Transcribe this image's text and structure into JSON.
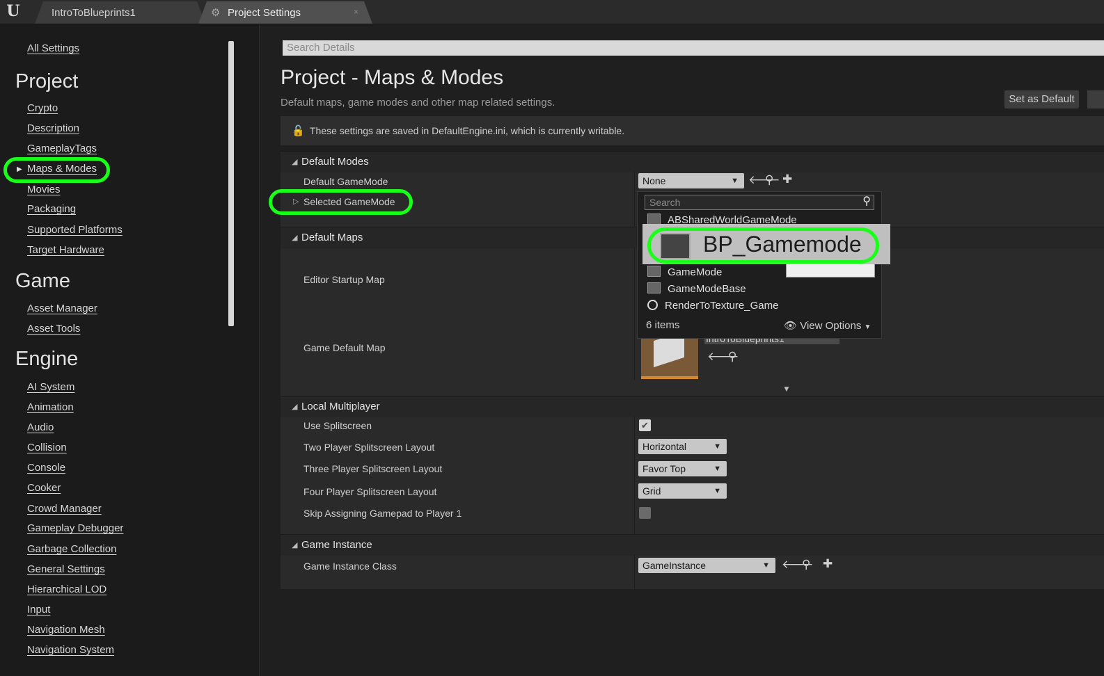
{
  "titlebar": {
    "tabs": [
      {
        "label": "IntroToBlueprints1"
      },
      {
        "label": "Project Settings"
      }
    ]
  },
  "sidebar": {
    "all_settings": "All Settings",
    "sections": [
      {
        "title": "Project",
        "items": [
          "Crypto",
          "Description",
          "GameplayTags",
          "Maps & Modes",
          "Movies",
          "Packaging",
          "Supported Platforms",
          "Target Hardware"
        ]
      },
      {
        "title": "Game",
        "items": [
          "Asset Manager",
          "Asset Tools"
        ]
      },
      {
        "title": "Engine",
        "items": [
          "AI System",
          "Animation",
          "Audio",
          "Collision",
          "Console",
          "Cooker",
          "Crowd Manager",
          "Gameplay Debugger",
          "Garbage Collection",
          "General Settings",
          "Hierarchical LOD",
          "Input",
          "Navigation Mesh",
          "Navigation System"
        ]
      }
    ],
    "selected": "Maps & Modes"
  },
  "main": {
    "search_placeholder": "Search Details",
    "title": "Project - Maps & Modes",
    "subtitle": "Default maps, game modes and other map related settings.",
    "set_default": "Set as Default",
    "notice": "These settings are saved in DefaultEngine.ini, which is currently writable.",
    "sections": {
      "default_modes": {
        "title": "Default Modes",
        "default_gamemode_label": "Default GameMode",
        "default_gamemode_value": "None",
        "selected_gamemode_label": "Selected GameMode"
      },
      "default_maps": {
        "title": "Default Maps",
        "editor_startup_map_label": "Editor Startup Map",
        "game_default_map_label": "Game Default Map",
        "game_default_map_value": "IntroToBlueprints1"
      },
      "local_multiplayer": {
        "title": "Local Multiplayer",
        "use_splitscreen_label": "Use Splitscreen",
        "two_player_label": "Two Player Splitscreen Layout",
        "two_player_value": "Horizontal",
        "three_player_label": "Three Player Splitscreen Layout",
        "three_player_value": "Favor Top",
        "four_player_label": "Four Player Splitscreen Layout",
        "four_player_value": "Grid",
        "skip_gamepad_label": "Skip Assigning Gamepad to Player 1"
      },
      "game_instance": {
        "title": "Game Instance",
        "class_label": "Game Instance Class",
        "class_value": "GameInstance"
      }
    }
  },
  "popup": {
    "search_placeholder": "Search",
    "items": [
      "ABSharedWorldGameMode",
      "BP_Gamemode",
      "GameMode",
      "GameModeBase",
      "RenderToTexture_Game"
    ],
    "count": "6 items",
    "view_options": "View Options"
  },
  "colors": {
    "highlight_ring": "#1aff1a"
  }
}
